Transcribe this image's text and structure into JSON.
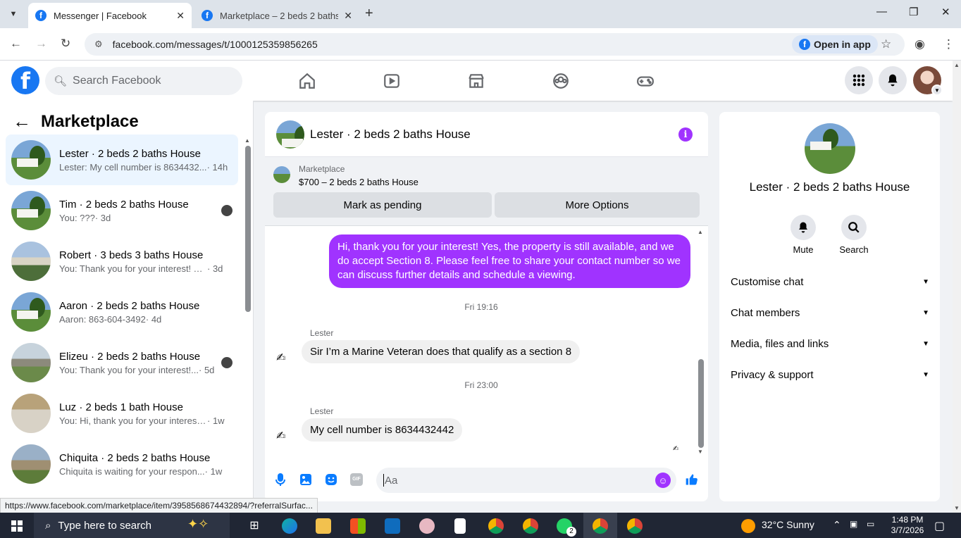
{
  "browser": {
    "tabs": [
      {
        "title": "Messenger | Facebook"
      },
      {
        "title": "Marketplace – 2 beds 2 baths H"
      }
    ],
    "url": "facebook.com/messages/t/1000125359856265",
    "open_in_app": "Open in app",
    "status_url": "https://www.facebook.com/marketplace/item/3958568674432894/?referralSurfac..."
  },
  "fb": {
    "search_placeholder": "Search Facebook"
  },
  "left": {
    "title": "Marketplace",
    "conversations": [
      {
        "name": "Lester · 2 beds 2 baths House",
        "preview": "Lester: My cell number is 8634432...",
        "time": "· 14h"
      },
      {
        "name": "Tim · 2 beds 2 baths House",
        "preview": "You: ???",
        "time": "· 3d"
      },
      {
        "name": "Robert · 3 beds 3 baths House",
        "preview": "You: Thank you for your interest! Ye...",
        "time": "· 3d"
      },
      {
        "name": "Aaron · 2 beds 2 baths House",
        "preview": "Aaron: 863-604-3492",
        "time": "· 4d"
      },
      {
        "name": "Elizeu · 2 beds 2 baths House",
        "preview": "You: Thank you for your interest!...",
        "time": "· 5d"
      },
      {
        "name": "Luz · 2 beds 1 bath House",
        "preview": "You: Hi, thank you for your interest!...",
        "time": "· 1w"
      },
      {
        "name": "Chiquita · 2 beds 2 baths House",
        "preview": "Chiquita is waiting for your respon...",
        "time": "· 1w"
      }
    ]
  },
  "chat": {
    "title": "Lester · 2 beds 2 baths House",
    "marketplace_label": "Marketplace",
    "listing": "$700 – 2 beds 2 baths House",
    "mark_pending": "Mark as pending",
    "more_options": "More Options",
    "messages": {
      "out1": "Hi, thank you for your interest! Yes, the property is still available, and we do accept Section 8. Please feel free to share your contact number so we can discuss further details and schedule a viewing.",
      "ts1": "Fri 19:16",
      "sender1": "Lester",
      "in1": "Sir I’m a Marine Veteran does that qualify as a section 8",
      "ts2": "Fri 23:00",
      "sender2": "Lester",
      "in2": "My cell number is 8634432442"
    },
    "input_placeholder": "Aa",
    "gif_label": "GIF"
  },
  "right": {
    "name": "Lester · 2 beds 2 baths House",
    "mute": "Mute",
    "search": "Search",
    "rows": [
      "Customise chat",
      "Chat members",
      "Media, files and links",
      "Privacy & support"
    ]
  },
  "taskbar": {
    "search_placeholder": "Type here to search",
    "weather": "32°C  Sunny",
    "time": "1:48 PM",
    "date": "3/7/2026",
    "whatsapp_badge": "2"
  },
  "colors": {
    "fb_blue": "#1877f2",
    "accent_purple": "#a033ff"
  }
}
